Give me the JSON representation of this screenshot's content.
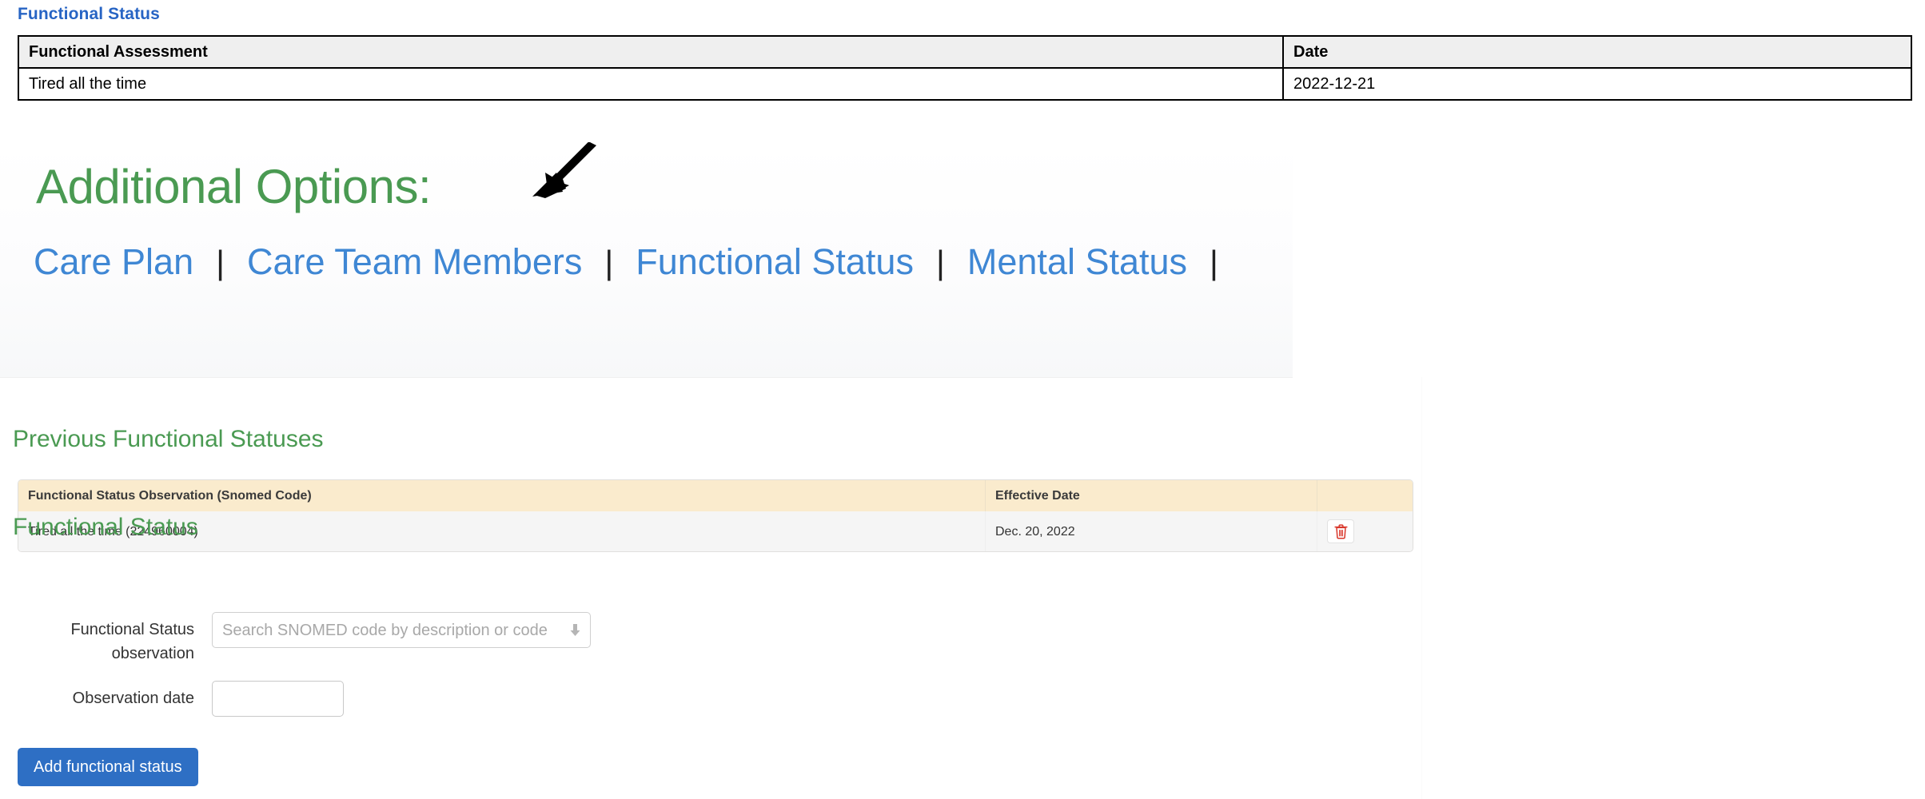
{
  "page": {
    "heading": "Functional Status"
  },
  "summary_table": {
    "columns": [
      "Functional Assessment",
      "Date"
    ],
    "rows": [
      {
        "assessment": "Tired all the time",
        "date": "2022-12-21"
      }
    ]
  },
  "additional_options": {
    "title": "Additional Options:",
    "links": [
      {
        "label": "Care Plan"
      },
      {
        "label": "Care Team Members"
      },
      {
        "label": "Functional Status"
      },
      {
        "label": "Mental Status"
      }
    ],
    "separator": "|",
    "annotation_icon": "arrow-pointing-down-left-icon"
  },
  "previous_statuses": {
    "heading": "Previous Functional Statuses",
    "columns": [
      "Functional Status Observation (Snomed Code)",
      "Effective Date",
      ""
    ],
    "rows": [
      {
        "observation": "Tired all the time (224960004)",
        "effective_date": "Dec. 20, 2022",
        "delete_icon": "trash-icon"
      }
    ]
  },
  "form": {
    "heading": "Functional Status",
    "fields": [
      {
        "label": "Functional Status observation",
        "placeholder": "Search SNOMED code by description or code",
        "value": "",
        "dropdown_icon": "arrow-down-icon"
      },
      {
        "label": "Observation date",
        "placeholder": "",
        "value": ""
      }
    ],
    "submit_label": "Add functional status"
  },
  "colors": {
    "heading_blue": "#2764c4",
    "heading_green": "#4a9a52",
    "link_blue": "#3f87d4",
    "button_blue": "#2e6fc4",
    "table_header_cream": "#faebcd",
    "delete_red": "#d9372b"
  }
}
